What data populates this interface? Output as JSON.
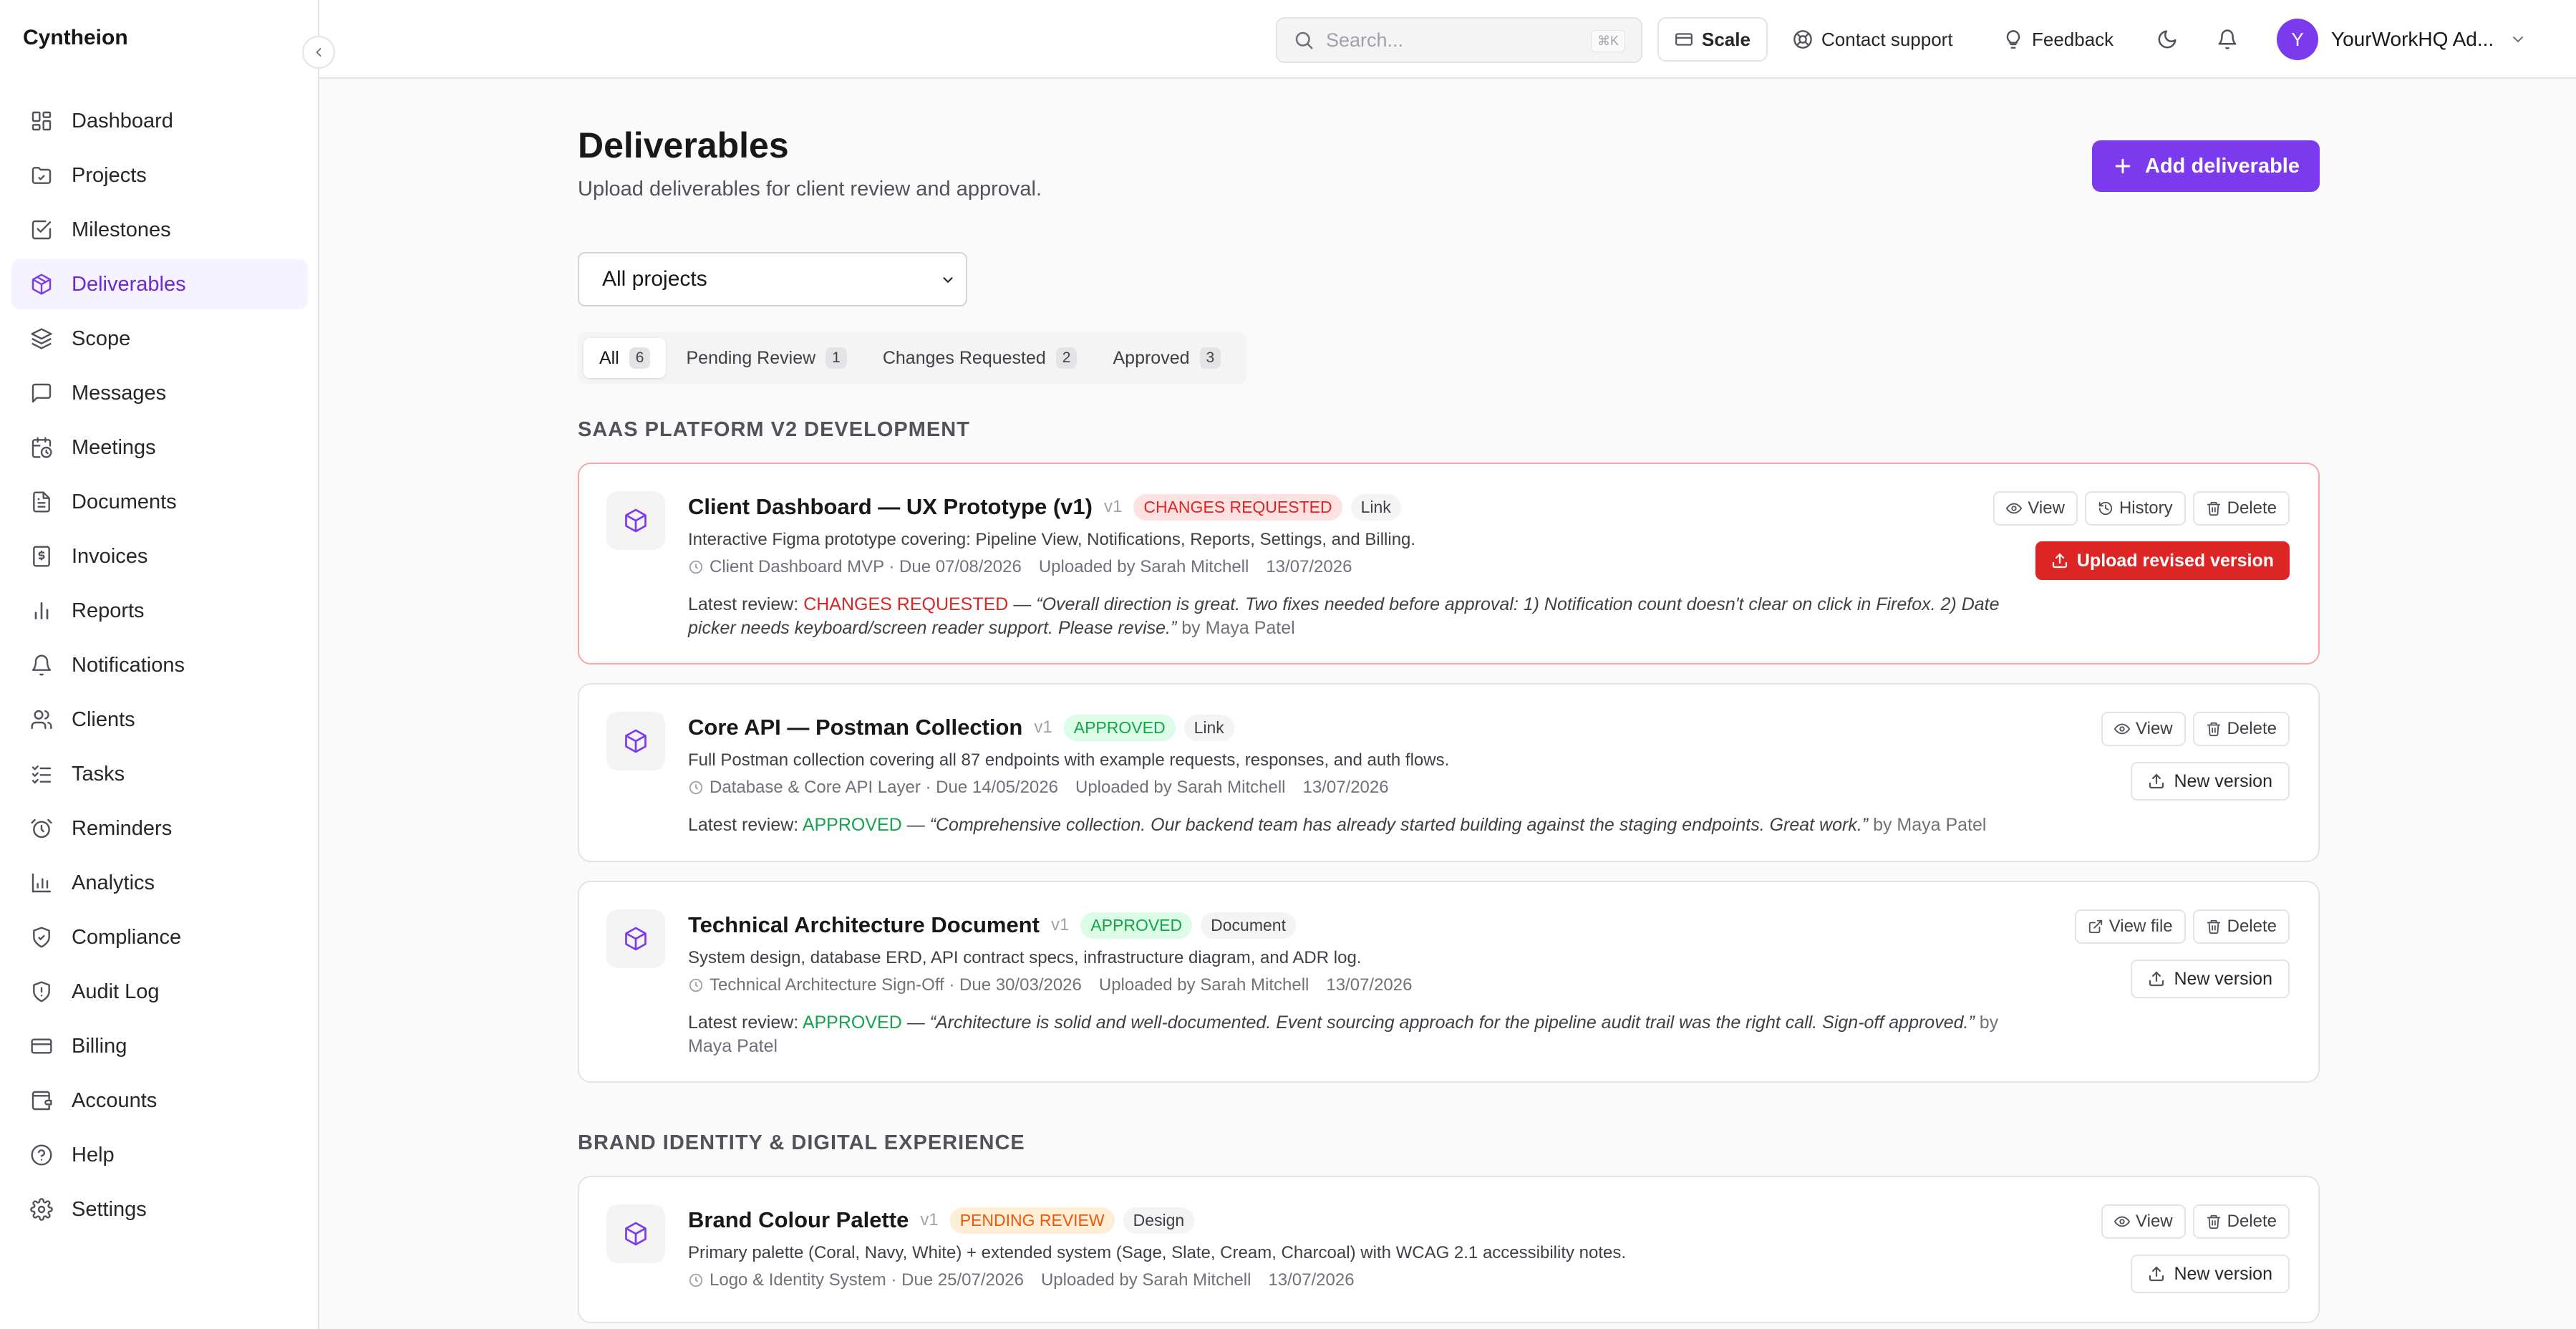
{
  "sidebar": {
    "brand": "Cyntheion",
    "items": [
      {
        "label": "Dashboard",
        "icon": "layout-dashboard-icon",
        "active": false
      },
      {
        "label": "Projects",
        "icon": "folder-icon",
        "active": false
      },
      {
        "label": "Milestones",
        "icon": "check-square-icon",
        "active": false
      },
      {
        "label": "Deliverables",
        "icon": "package-icon",
        "active": true
      },
      {
        "label": "Scope",
        "icon": "layers-icon",
        "active": false
      },
      {
        "label": "Messages",
        "icon": "message-icon",
        "active": false
      },
      {
        "label": "Meetings",
        "icon": "calendar-clock-icon",
        "active": false
      },
      {
        "label": "Documents",
        "icon": "file-text-icon",
        "active": false
      },
      {
        "label": "Invoices",
        "icon": "receipt-icon",
        "active": false
      },
      {
        "label": "Reports",
        "icon": "bar-chart-icon",
        "active": false
      },
      {
        "label": "Notifications",
        "icon": "bell-icon",
        "active": false
      },
      {
        "label": "Clients",
        "icon": "users-icon",
        "active": false
      },
      {
        "label": "Tasks",
        "icon": "list-checks-icon",
        "active": false
      },
      {
        "label": "Reminders",
        "icon": "alarm-clock-icon",
        "active": false
      },
      {
        "label": "Analytics",
        "icon": "line-chart-icon",
        "active": false
      },
      {
        "label": "Compliance",
        "icon": "shield-check-icon",
        "active": false
      },
      {
        "label": "Audit Log",
        "icon": "shield-alert-icon",
        "active": false
      },
      {
        "label": "Billing",
        "icon": "credit-card-icon",
        "active": false
      },
      {
        "label": "Accounts",
        "icon": "wallet-icon",
        "active": false
      },
      {
        "label": "Help",
        "icon": "help-circle-icon",
        "active": false
      },
      {
        "label": "Settings",
        "icon": "gear-icon",
        "active": false
      }
    ]
  },
  "header": {
    "search_placeholder": "Search...",
    "search_shortcut": "⌘K",
    "scale_label": "Scale",
    "support_label": "Contact support",
    "feedback_label": "Feedback",
    "user_initial": "Y",
    "user_name": "YourWorkHQ Ad..."
  },
  "page": {
    "title": "Deliverables",
    "subtitle": "Upload deliverables for client review and approval.",
    "add_button": "Add deliverable",
    "project_filter": "All projects",
    "tabs": [
      {
        "label": "All",
        "count": "6",
        "active": true
      },
      {
        "label": "Pending Review",
        "count": "1",
        "active": false
      },
      {
        "label": "Changes Requested",
        "count": "2",
        "active": false
      },
      {
        "label": "Approved",
        "count": "3",
        "active": false
      }
    ]
  },
  "sections": [
    {
      "label": "SAAS PLATFORM V2 DEVELOPMENT"
    },
    {
      "label": "BRAND IDENTITY & DIGITAL EXPERIENCE"
    }
  ],
  "cards": [
    {
      "title": "Client Dashboard — UX Prototype (v1)",
      "version": "v1",
      "status": "CHANGES REQUESTED",
      "tag": "Link",
      "description": "Interactive Figma prototype covering: Pipeline View, Notifications, Reports, Settings, and Billing.",
      "milestone": "Client Dashboard MVP · Due 07/08/2026",
      "uploaded": "Uploaded by Sarah Mitchell",
      "date": "13/07/2026",
      "review_prefix": "Latest review:",
      "review_status": "CHANGES REQUESTED",
      "review_dash": "—",
      "review_quote": "“Overall direction is great. Two fixes needed before approval: 1) Notification count doesn't clear on click in Firefox. 2) Date picker needs keyboard/screen reader support. Please revise.”",
      "review_by": "by Maya Patel",
      "actions": [
        "View",
        "History",
        "Delete"
      ],
      "version_button": "Upload revised version"
    },
    {
      "title": "Core API — Postman Collection",
      "version": "v1",
      "status": "APPROVED",
      "tag": "Link",
      "description": "Full Postman collection covering all 87 endpoints with example requests, responses, and auth flows.",
      "milestone": "Database & Core API Layer · Due 14/05/2026",
      "uploaded": "Uploaded by Sarah Mitchell",
      "date": "13/07/2026",
      "review_prefix": "Latest review:",
      "review_status": "APPROVED",
      "review_dash": "—",
      "review_quote": "“Comprehensive collection. Our backend team has already started building against the staging endpoints. Great work.”",
      "review_by": "by Maya Patel",
      "actions": [
        "View",
        "Delete"
      ],
      "version_button": "New version"
    },
    {
      "title": "Technical Architecture Document",
      "version": "v1",
      "status": "APPROVED",
      "tag": "Document",
      "description": "System design, database ERD, API contract specs, infrastructure diagram, and ADR log.",
      "milestone": "Technical Architecture Sign-Off · Due 30/03/2026",
      "uploaded": "Uploaded by Sarah Mitchell",
      "date": "13/07/2026",
      "review_prefix": "Latest review:",
      "review_status": "APPROVED",
      "review_dash": "—",
      "review_quote": "“Architecture is solid and well-documented. Event sourcing approach for the pipeline audit trail was the right call. Sign-off approved.”",
      "review_by": "by Maya Patel",
      "actions": [
        "View file",
        "Delete"
      ],
      "version_button": "New version"
    },
    {
      "title": "Brand Colour Palette",
      "version": "v1",
      "status": "PENDING REVIEW",
      "tag": "Design",
      "description": "Primary palette (Coral, Navy, White) + extended system (Sage, Slate, Cream, Charcoal) with WCAG 2.1 accessibility notes.",
      "milestone": "Logo & Identity System · Due 25/07/2026",
      "uploaded": "Uploaded by Sarah Mitchell",
      "date": "13/07/2026",
      "actions": [
        "View",
        "Delete"
      ],
      "version_button": "New version"
    }
  ],
  "colors": {
    "accent": "#7c3aed",
    "danger": "#dc2626",
    "success": "#16a34a",
    "warning": "#ea580c"
  }
}
